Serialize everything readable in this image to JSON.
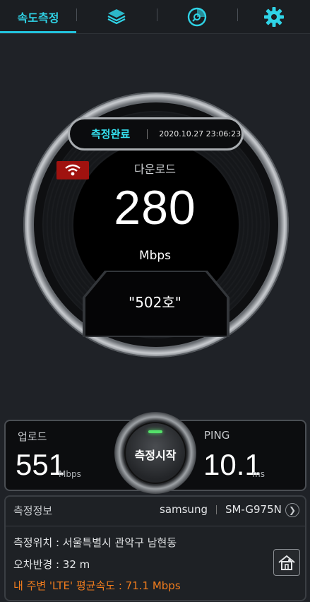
{
  "tabs": [
    {
      "label": "속도측정",
      "icon": null,
      "active": true
    },
    {
      "label": "",
      "icon": "layers-icon",
      "active": false
    },
    {
      "label": "",
      "icon": "disc-icon",
      "active": false
    },
    {
      "label": "",
      "icon": "gear-icon",
      "active": false
    }
  ],
  "gauge": {
    "status": "측정완료",
    "datetime": "2020.10.27 23:06:23",
    "network_icon": "wifi-icon",
    "download_label": "다운로드",
    "download_value": "280",
    "download_unit": "Mbps",
    "location_name": "\"502호\""
  },
  "results": {
    "upload_label": "업로드",
    "upload_value": "551",
    "upload_unit": "Mbps",
    "start_button": "측정시작",
    "ping_label": "PING",
    "ping_value": "10.1",
    "ping_unit": "ms"
  },
  "info": {
    "title": "측정정보",
    "manufacturer": "samsung",
    "model": "SM-G975N",
    "location": "측정위치 : 서울특별시 관악구 남현동",
    "error_radius": "오차반경 : 32 m",
    "average_speed": "내 주변 'LTE' 평균속도 : 71.1 Mbps"
  },
  "colors": {
    "accent": "#22c2dc",
    "status_text": "#35e1f0",
    "badge_red": "#a0120f",
    "average_orange": "#f07c1d",
    "led_green": "#54e06a"
  }
}
